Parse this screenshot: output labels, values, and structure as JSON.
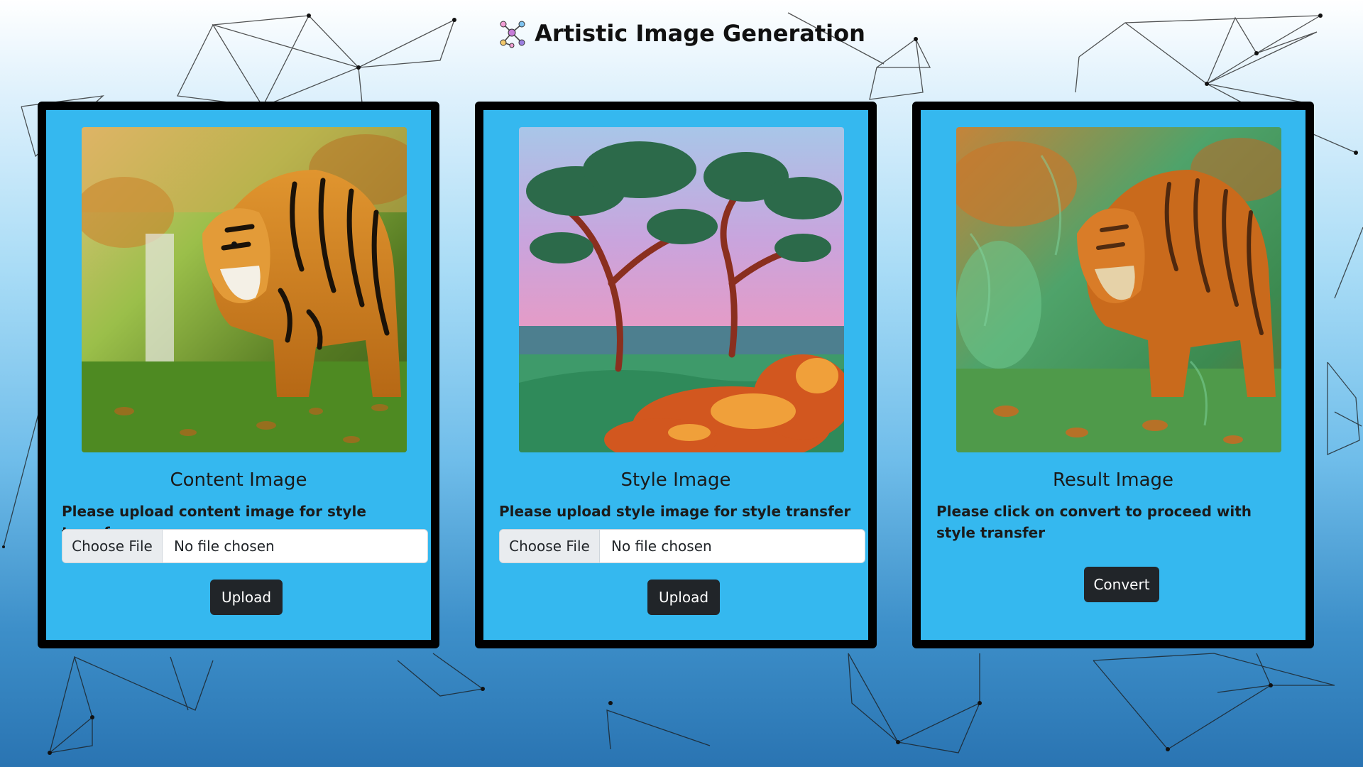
{
  "header": {
    "title": "Artistic Image Generation",
    "logo_icon": "molecule-network-icon"
  },
  "cards": [
    {
      "title": "Content Image",
      "instruction": "Please upload content image for style transfer",
      "choose_label": "Choose File",
      "file_status": "No file chosen",
      "button_label": "Upload",
      "image": "tiger-photo"
    },
    {
      "title": "Style Image",
      "instruction": "Please upload style image for style transfer",
      "choose_label": "Choose File",
      "file_status": "No file chosen",
      "button_label": "Upload",
      "image": "impressionist-trees-painting"
    },
    {
      "title": "Result Image",
      "instruction": "Please click on convert to proceed with style transfer",
      "button_label": "Convert",
      "image": "stylized-tiger"
    }
  ],
  "colors": {
    "card_background": "#35b8ef",
    "card_border": "#000000",
    "button_background": "#212529",
    "button_text": "#ffffff"
  }
}
